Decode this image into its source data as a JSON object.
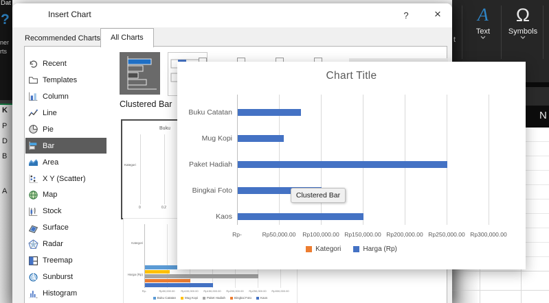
{
  "colors": {
    "accent_blue": "#4472C4",
    "accent_orange": "#ED7D31",
    "excel_green": "#107C41",
    "selection_gray": "#5c5c5c"
  },
  "ribbon": {
    "tab_fragment": "Dat",
    "help_icon_fragment": "?",
    "label_fragments": [
      "ner",
      "rts"
    ],
    "partial_button_fragment": "t",
    "buttons": [
      {
        "label": "Text",
        "icon": "text-styled-a-icon"
      },
      {
        "label": "Symbols",
        "icon": "omega-icon"
      }
    ],
    "cell_fragment": "N"
  },
  "worksheet": {
    "left_cell_fragments": [
      "K",
      "P",
      "D",
      "B",
      "A"
    ]
  },
  "dialog": {
    "title": "Insert Chart",
    "help_label": "?",
    "close_label": "×",
    "tabs": [
      {
        "label": "Recommended Charts",
        "active": false
      },
      {
        "label": "All Charts",
        "active": true
      }
    ],
    "sidebar": {
      "items": [
        {
          "label": "Recent",
          "icon": "recent-icon",
          "selected": false
        },
        {
          "label": "Templates",
          "icon": "templates-icon",
          "selected": false
        },
        {
          "label": "Column",
          "icon": "column-chart-icon",
          "selected": false
        },
        {
          "label": "Line",
          "icon": "line-chart-icon",
          "selected": false
        },
        {
          "label": "Pie",
          "icon": "pie-chart-icon",
          "selected": false
        },
        {
          "label": "Bar",
          "icon": "bar-chart-icon",
          "selected": true
        },
        {
          "label": "Area",
          "icon": "area-chart-icon",
          "selected": false
        },
        {
          "label": "X Y (Scatter)",
          "icon": "scatter-chart-icon",
          "selected": false
        },
        {
          "label": "Map",
          "icon": "map-chart-icon",
          "selected": false
        },
        {
          "label": "Stock",
          "icon": "stock-chart-icon",
          "selected": false
        },
        {
          "label": "Surface",
          "icon": "surface-chart-icon",
          "selected": false
        },
        {
          "label": "Radar",
          "icon": "radar-chart-icon",
          "selected": false
        },
        {
          "label": "Treemap",
          "icon": "treemap-chart-icon",
          "selected": false
        },
        {
          "label": "Sunburst",
          "icon": "sunburst-chart-icon",
          "selected": false
        },
        {
          "label": "Histogram",
          "icon": "histogram-chart-icon",
          "selected": false
        }
      ]
    },
    "subtype_heading": "Clustered Bar",
    "preview1": {
      "category_fragment": "Buku",
      "axis_label": "Kategori",
      "ticks": [
        "0",
        "0.2"
      ]
    }
  },
  "tooltip": {
    "text": "Clustered Bar"
  },
  "chart_data": [
    {
      "id": "hover-preview-large",
      "type": "bar",
      "orientation": "horizontal",
      "title": "Chart Title",
      "categories": [
        "Buku Catatan",
        "Mug Kopi",
        "Paket Hadiah",
        "Bingkai Foto",
        "Kaos"
      ],
      "series": [
        {
          "name": "Kategori",
          "color": "#ED7D31",
          "values": [
            0,
            0,
            0,
            0,
            0
          ],
          "note": "bars too small to be visible at Rp scale"
        },
        {
          "name": "Harga (Rp)",
          "color": "#4472C4",
          "values": [
            75000,
            55000,
            250000,
            100000,
            150000
          ]
        }
      ],
      "x_ticks": [
        "Rp-",
        "Rp50,000.00",
        "Rp100,000.00",
        "Rp150,000.00",
        "Rp200,000.00",
        "Rp250,000.00",
        "Rp300,000.00"
      ],
      "xlabel": "",
      "ylabel": "",
      "xlim": [
        0,
        300000
      ],
      "gridlines": true,
      "legend_position": "bottom"
    },
    {
      "id": "dialog-preview-small",
      "type": "bar",
      "orientation": "horizontal",
      "title": "",
      "categories": [
        "Kategori",
        "Harga (Rp)"
      ],
      "series": [
        {
          "name": "Buku Catatan",
          "color": "#5B9BD5",
          "values": [
            0,
            75000
          ]
        },
        {
          "name": "Mug Kopi",
          "color": "#FFC000",
          "values": [
            0,
            55000
          ]
        },
        {
          "name": "Paket Hadiah",
          "color": "#A5A5A5",
          "values": [
            0,
            250000
          ]
        },
        {
          "name": "Bingkai Foto",
          "color": "#ED7D31",
          "values": [
            0,
            100000
          ]
        },
        {
          "name": "Kaos",
          "color": "#4472C4",
          "values": [
            0,
            150000
          ]
        }
      ],
      "x_ticks": [
        "Rp-",
        "Rp50,000.00",
        "Rp100,000.00",
        "Rp150,000.00",
        "Rp200,000.00",
        "Rp250,000.00",
        "Rp300,000.00"
      ],
      "xlim": [
        0,
        300000
      ],
      "gridlines": true,
      "legend_position": "bottom"
    }
  ]
}
